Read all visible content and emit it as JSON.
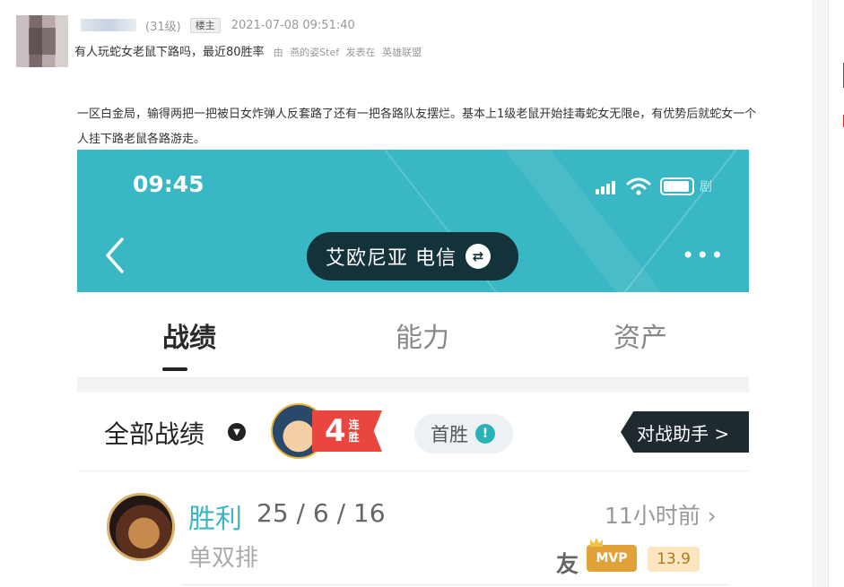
{
  "post": {
    "level": "(31级)",
    "op_badge": "楼主",
    "timestamp": "2021-07-08 09:51:40",
    "title": "有人玩蛇女老鼠下路吗，最近80胜率",
    "by_label": "由",
    "author": "燕的姿Stef",
    "posted_in_label": "发表在",
    "forum": "英雄联盟",
    "body": "一区白金局，输得两把一把被日女炸弹人反套路了还有一把各路队友摆烂。基本上1级老鼠开始挂毒蛇女无限e，有优势后就蛇女一个人挂下路老鼠各路游走。"
  },
  "screenshot": {
    "clock": "09:45",
    "battery_watermark": "剧",
    "server": "艾欧尼亚 电信",
    "swap_icon": "⇄",
    "more": "•••",
    "tabs": [
      "战绩",
      "能力",
      "资产"
    ],
    "filter": {
      "all_records": "全部战绩",
      "streak_number": "4",
      "streak_text": "连胜",
      "first_win": "首胜",
      "first_win_icon": "!",
      "assistant": "对战助手 >"
    },
    "match": {
      "result": "胜利",
      "kda": "25 / 6 / 16",
      "mode": "单双排",
      "time_ago": "11小时前 ›",
      "friend": "友",
      "mvp": "MVP",
      "score": "13.9"
    }
  },
  "colors": {
    "header_teal": "#3ab7c4",
    "win_teal": "#3ab7c4",
    "mvp_gold": "#e2a23a",
    "streak_red": "#e8463f"
  },
  "icons": {
    "back": "chevron-left-icon",
    "dropdown": "chevron-down-icon",
    "wifi": "wifi-icon",
    "battery": "battery-icon",
    "signal": "signal-icon"
  }
}
